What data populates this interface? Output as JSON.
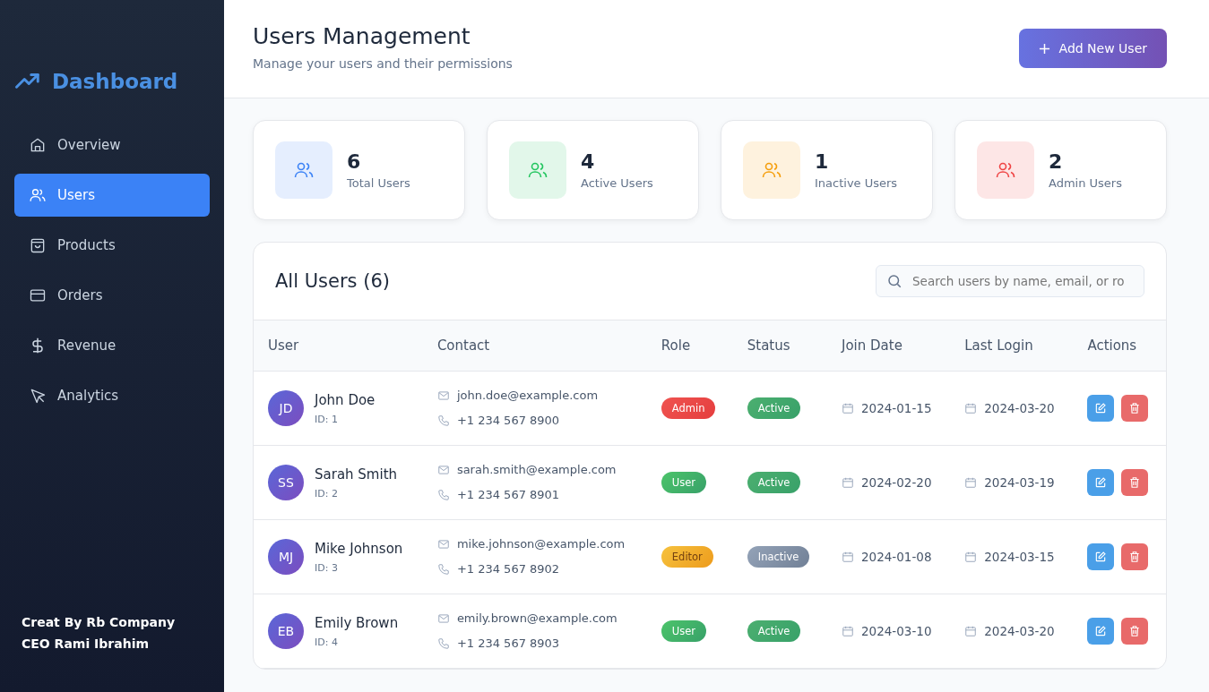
{
  "sidebar": {
    "brand": "Dashboard",
    "items": [
      {
        "label": "Overview",
        "kind": "home",
        "selected": false
      },
      {
        "label": "Users",
        "kind": "users",
        "selected": true
      },
      {
        "label": "Products",
        "kind": "bag",
        "selected": false
      },
      {
        "label": "Orders",
        "kind": "card",
        "selected": false
      },
      {
        "label": "Revenue",
        "kind": "dollar",
        "selected": false
      },
      {
        "label": "Analytics",
        "kind": "cursor",
        "selected": false
      }
    ],
    "footer": [
      "Creat By Rb Company",
      "CEO Rami Ibrahim"
    ]
  },
  "header": {
    "title": "Users Management",
    "subtitle": "Manage your users and their permissions",
    "add_button": "Add New User"
  },
  "stats": [
    {
      "value": "6",
      "label": "Total Users",
      "color": "#3b82f6"
    },
    {
      "value": "4",
      "label": "Active Users",
      "color": "#22c55e"
    },
    {
      "value": "1",
      "label": "Inactive Users",
      "color": "#f59e0b"
    },
    {
      "value": "2",
      "label": "Admin Users",
      "color": "#ef4444"
    }
  ],
  "table": {
    "title": "All Users (6)",
    "search": {
      "placeholder": "Search users by name, email, or ro"
    },
    "columns": [
      "User",
      "Contact",
      "Role",
      "Status",
      "Join Date",
      "Last Login",
      "Actions"
    ],
    "rows": [
      {
        "initials": "JD",
        "name": "John Doe",
        "id": "ID: 1",
        "email": "john.doe@example.com",
        "phone": "+1 234 567 8900",
        "role": {
          "text": "Admin",
          "kind": "admin"
        },
        "status": "Active",
        "active": true,
        "join": "2024-01-15",
        "login": "2024-03-20"
      },
      {
        "initials": "SS",
        "name": "Sarah Smith",
        "id": "ID: 2",
        "email": "sarah.smith@example.com",
        "phone": "+1 234 567 8901",
        "role": {
          "text": "User",
          "kind": "user"
        },
        "status": "Active",
        "active": true,
        "join": "2024-02-20",
        "login": "2024-03-19"
      },
      {
        "initials": "MJ",
        "name": "Mike Johnson",
        "id": "ID: 3",
        "email": "mike.johnson@example.com",
        "phone": "+1 234 567 8902",
        "role": {
          "text": "Editor",
          "kind": "editor"
        },
        "status": "Inactive",
        "active": false,
        "join": "2024-01-08",
        "login": "2024-03-15"
      },
      {
        "initials": "EB",
        "name": "Emily Brown",
        "id": "ID: 4",
        "email": "emily.brown@example.com",
        "phone": "+1 234 567 8903",
        "role": {
          "text": "User",
          "kind": "user"
        },
        "status": "Active",
        "active": true,
        "join": "2024-03-10",
        "login": "2024-03-20"
      }
    ]
  }
}
